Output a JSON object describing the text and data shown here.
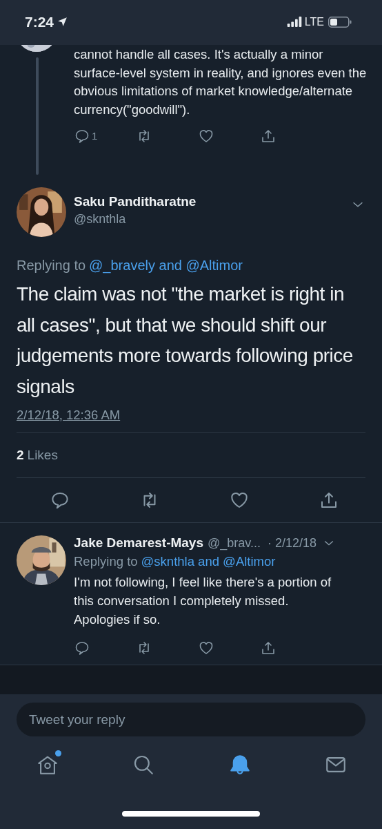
{
  "status_bar": {
    "time": "7:24",
    "network": "LTE"
  },
  "thread_tweet": {
    "text": "cannot handle all cases. It's actually a minor surface-level system in reality, and ignores even the obvious limitations of market knowledge/alternate currency(\"goodwill\").",
    "actions": [
      {
        "kind": "reply",
        "count": "1"
      },
      {
        "kind": "retweet"
      },
      {
        "kind": "like"
      },
      {
        "kind": "share"
      }
    ]
  },
  "main_tweet": {
    "name": "Saku Panditharatne",
    "handle": "@sknthla",
    "replying_label": "Replying to",
    "replying_mentions": "@_bravely and @Altimor",
    "text": "The claim was not \"the market is right in all cases\", but that we should shift our judgements more towards following price signals",
    "timestamp": "2/12/18, 12:36 AM",
    "likes_count": "2",
    "likes_label": "Likes",
    "actions": [
      {
        "kind": "reply"
      },
      {
        "kind": "retweet"
      },
      {
        "kind": "like"
      },
      {
        "kind": "share"
      }
    ]
  },
  "reply_tweet": {
    "name": "Jake Demarest-Mays",
    "handle": "@_brav...",
    "date": "· 2/12/18",
    "replying_label": "Replying to",
    "replying_mentions": "@sknthla and @Altimor",
    "text": "I'm not following, I feel like there's a portion of this conversation I completely missed. Apologies if so.",
    "actions": [
      {
        "kind": "reply"
      },
      {
        "kind": "retweet"
      },
      {
        "kind": "like"
      },
      {
        "kind": "share"
      }
    ]
  },
  "reply_box": {
    "placeholder": "Tweet your reply"
  },
  "nav_tabs": [
    {
      "kind": "home",
      "selected": false,
      "badge": true
    },
    {
      "kind": "search",
      "selected": false,
      "badge": false
    },
    {
      "kind": "notifications",
      "selected": true,
      "badge": false
    },
    {
      "kind": "messages",
      "selected": false,
      "badge": false
    }
  ]
}
